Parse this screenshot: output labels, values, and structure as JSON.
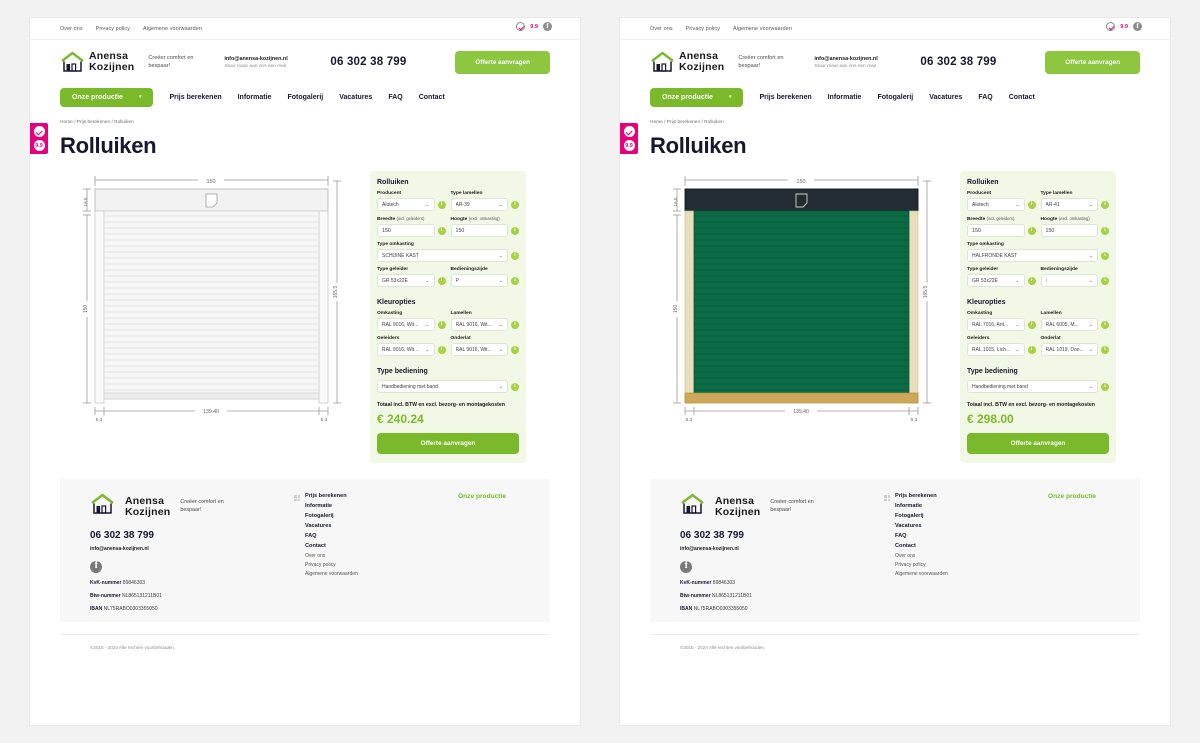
{
  "topbar": {
    "links": [
      "Over ons",
      "Privacy policy",
      "Algemene voorwaarden"
    ],
    "rating": "9.9"
  },
  "header": {
    "brand_line1": "Anensa",
    "brand_line2": "Kozijnen",
    "tagline": "Creëer comfort en bespaar!",
    "email": "info@anensa-kozijnen.nl",
    "email_sub": "Stuur maar aan ons een mail",
    "phone": "06 302 38 799",
    "cta": "Offerte aanvragen"
  },
  "nav": {
    "primary": "Onze productie",
    "caret": "▾",
    "links": [
      "Prijs berekenen",
      "Informatie",
      "Fotogalerij",
      "Vacatures",
      "FAQ",
      "Contact"
    ]
  },
  "breadcrumb": "Home / Prijs berekenen / Rolluiken",
  "page_title": "Rolluiken",
  "drawing": {
    "top_width": "150",
    "box_height": "16.5",
    "left_height": "150",
    "right_height": "165.5",
    "inner_width": "139.40",
    "left_margin": "5.3",
    "right_margin": "5.3"
  },
  "panels": [
    {
      "heading": "Rolluiken",
      "producent_label": "Producent",
      "producent_value": "Alutech",
      "lamellen_label": "Type lamellen",
      "lamellen_value": "AR-39",
      "breedte_label": "Breedte",
      "breedte_note": "(incl. geleiders)",
      "breedte_value": "150",
      "hoogte_label": "Hoogte",
      "hoogte_note": "(excl. omkasting)",
      "hoogte_value": "150",
      "omkasting_label": "Type omkasting",
      "omkasting_value": "SCHUINE KAST",
      "geleider_label": "Type geleider",
      "geleider_value": "GR 53x22E",
      "bediening_zijde_label": "Bedieningszijde",
      "bediening_zijde_value": "P",
      "kleuropties_heading": "Kleuropties",
      "kleur_omkasting_label": "Omkasting",
      "kleur_omkasting_value": "RAL 9016, Wit...",
      "kleur_lamellen_label": "Lamellen",
      "kleur_lamellen_value": "RAL 9016, Wit...",
      "kleur_geleiders_label": "Geleiders",
      "kleur_geleiders_value": "RAL 9016, Wit...",
      "kleur_onderlat_label": "Onderlat",
      "kleur_onderlat_value": "RAL 9016, Wit...",
      "bediening_heading": "Type bediening",
      "bediening_value": "Handbediening met band",
      "total_label": "Totaal incl. BTW en excl. bezorg- en montagekosten",
      "price": "€ 240.24",
      "cta": "Offerte aanvragen",
      "info_glyph": "i",
      "chevron": "⌄",
      "colors": {
        "box": "#f2f2f2",
        "slats": "#f4f4f4",
        "guides": "#fafafa",
        "bottom": "#ededed",
        "outline": "#b9b9b9"
      }
    },
    {
      "heading": "Rolluiken",
      "producent_label": "Producent",
      "producent_value": "Alutech",
      "lamellen_label": "Type lamellen",
      "lamellen_value": "AR-41",
      "breedte_label": "Breedte",
      "breedte_note": "(incl. geleiders)",
      "breedte_value": "150",
      "hoogte_label": "Hoogte",
      "hoogte_note": "(excl. omkasting)",
      "hoogte_value": "150",
      "omkasting_label": "Type omkasting",
      "omkasting_value": "HALFRONDE KAST",
      "geleider_label": "Type geleider",
      "geleider_value": "GR 53x22E",
      "bediening_zijde_label": "Bedieningszijde",
      "bediening_zijde_value": "l",
      "kleuropties_heading": "Kleuropties",
      "kleur_omkasting_label": "Omkasting",
      "kleur_omkasting_value": "RAL 7016, Ant...",
      "kleur_lamellen_label": "Lamellen",
      "kleur_lamellen_value": "RAL 6005, M...",
      "kleur_geleiders_label": "Geleiders",
      "kleur_geleiders_value": "RAL 1015, Lich...",
      "kleur_onderlat_label": "Onderlat",
      "kleur_onderlat_value": "RAL 1019, Don...",
      "bediening_heading": "Type bediening",
      "bediening_value": "Handbediening met band",
      "total_label": "Totaal incl. BTW en excl. bezorg- en montagekosten",
      "price": "€ 298.00",
      "cta": "Offerte aanvragen",
      "info_glyph": "i",
      "chevron": "⌄",
      "colors": {
        "box": "#232c33",
        "slats": "#0b6b46",
        "guides": "#e9debb",
        "bottom": "#cfa759",
        "outline": "#4a4a4a"
      }
    }
  ],
  "footer": {
    "brand_line1": "Anensa",
    "brand_line2": "Kozijnen",
    "tagline": "Creëer comfort en bespaar!",
    "phone": "06 302 38 799",
    "email": "info@anensa-kozijnen.nl",
    "kvk_label": "KvK-nummer",
    "kvk_value": "89846303",
    "btw_label": "Btw-nummer",
    "btw_value": "NL865131211B01",
    "iban_label": "IBAN",
    "iban_value": "NL75RABO0303355050",
    "links": [
      "Prijs berekenen",
      "Informatie",
      "Fotogalerij",
      "Vacatures",
      "FAQ",
      "Contact"
    ],
    "sublinks": [
      "Over ons",
      "Privacy policy",
      "Algemene voorwaarden"
    ],
    "products_heading": "Onze productie",
    "copyright": "©2015 - 2024 Alle rechten voorbehouden."
  },
  "side_widget": {
    "rating": "9.9"
  }
}
